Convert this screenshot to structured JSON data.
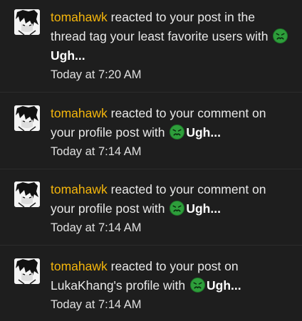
{
  "notifications": [
    {
      "user": "tomahawk",
      "text": " reacted to your post in the thread tag your least favorite users with ",
      "reaction": "Ugh...",
      "reaction_icon": "sick-face-icon",
      "time": "Today at 7:20 AM"
    },
    {
      "user": "tomahawk",
      "text": " reacted to your comment on your profile post with ",
      "reaction": "Ugh...",
      "reaction_icon": "sick-face-icon",
      "time": "Today at 7:14 AM"
    },
    {
      "user": "tomahawk",
      "text": " reacted to your comment on your profile post with ",
      "reaction": "Ugh...",
      "reaction_icon": "sick-face-icon",
      "time": "Today at 7:14 AM"
    },
    {
      "user": "tomahawk",
      "text": " reacted to your post on LukaKhang's profile with ",
      "reaction": "Ugh...",
      "reaction_icon": "sick-face-icon",
      "time": "Today at 7:14 AM"
    }
  ],
  "colors": {
    "background": "#1e1e1e",
    "username": "#f5b60c",
    "text": "#e9e9e9",
    "emoji": "#2e9e3b"
  }
}
